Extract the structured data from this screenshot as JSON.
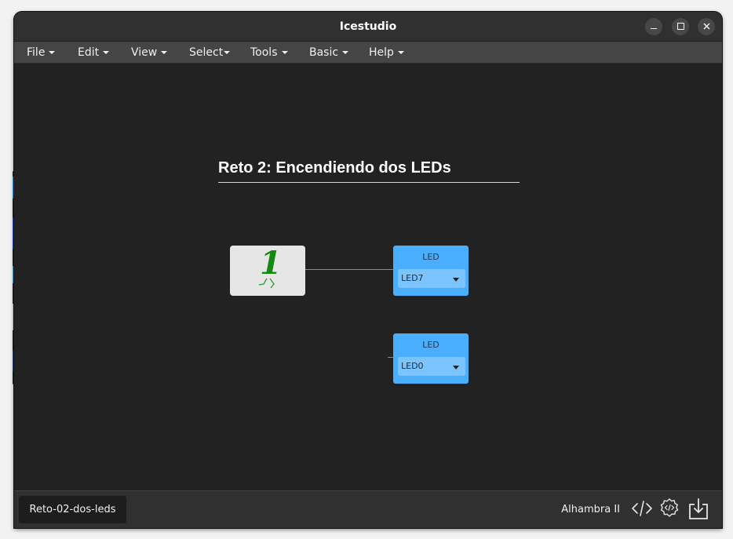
{
  "window": {
    "title": "Icestudio"
  },
  "menubar": {
    "items": [
      "File",
      "Edit",
      "View",
      "Select",
      "Tools",
      "Basic",
      "Help"
    ]
  },
  "canvas": {
    "heading": "Reto 2: Encendiendo dos LEDs",
    "constant_block": {
      "value": "1"
    },
    "led_blocks": [
      {
        "title": "LED",
        "selected_pin": "LED7"
      },
      {
        "title": "LED",
        "selected_pin": "LED0"
      }
    ]
  },
  "statusbar": {
    "project_tab": "Reto-02-dos-leds",
    "board": "Alhambra II",
    "icons": [
      "code-icon",
      "verify-gear-icon",
      "upload-icon"
    ]
  },
  "colors": {
    "canvas_bg": "#222222",
    "led_block": "#4aaeff",
    "constant_digit": "#138a13"
  }
}
